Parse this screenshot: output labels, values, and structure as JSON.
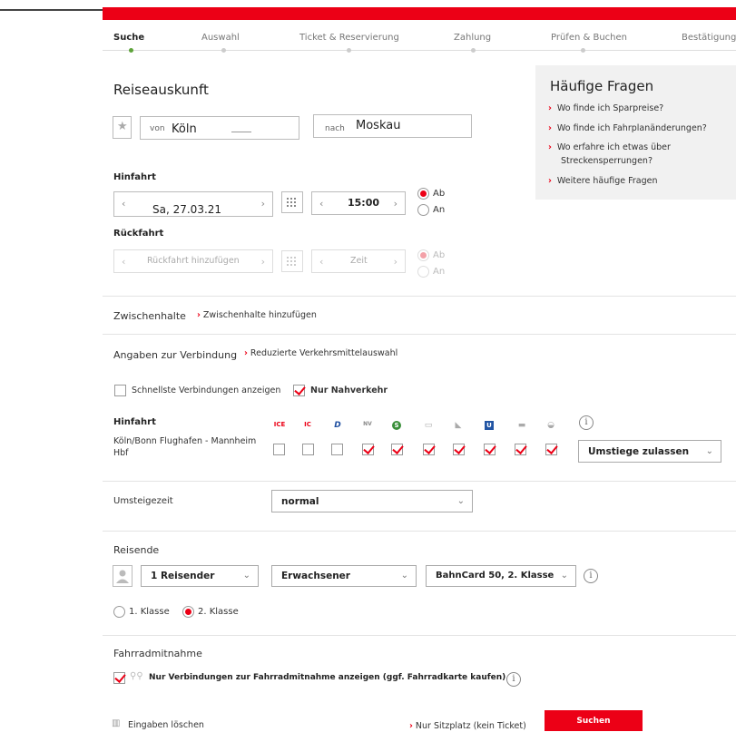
{
  "steps": [
    "Suche",
    "Auswahl",
    "Ticket & Reservierung",
    "Zahlung",
    "Prüfen & Buchen",
    "Bestätigung"
  ],
  "faq": {
    "title": "Häufige Fragen",
    "items": [
      "Wo finde ich Sparpreise?",
      "Wo finde ich Fahrplanänderungen?",
      "Wo erfahre ich etwas über Streckensperrungen?",
      "Weitere häufige Fragen"
    ]
  },
  "search": {
    "title": "Reiseauskunft",
    "from_label": "von",
    "from_value": "Köln",
    "to_label": "nach",
    "to_value": "Moskau"
  },
  "outbound": {
    "title": "Hinfahrt",
    "date": "Sa, 27.03.21",
    "time": "15:00",
    "ab": "Ab",
    "an": "An"
  },
  "return": {
    "title": "Rückfahrt",
    "date_placeholder": "Rückfahrt hinzufügen",
    "time_placeholder": "Zeit",
    "ab": "Ab",
    "an": "An"
  },
  "stops": {
    "label": "Zwischenhalte",
    "link": "Zwischenhalte hinzufügen"
  },
  "connection": {
    "label": "Angaben zur Verbindung",
    "link": "Reduzierte Verkehrsmittelauswahl",
    "fastest": "Schnellste Verbindungen anzeigen",
    "local_only": "Nur Nahverkehr",
    "hin_label": "Hinfahrt",
    "route": "Köln/Bonn Flughafen - Mannheim Hbf",
    "modes": [
      "ICE",
      "IC",
      "D",
      "NV",
      "S",
      "Bus",
      "Schiff",
      "U",
      "Tram",
      "Taxi"
    ],
    "mode_checked": [
      false,
      false,
      false,
      true,
      true,
      true,
      true,
      true,
      true,
      true
    ],
    "transfer_select": "Umstiege zulassen"
  },
  "transfer_time": {
    "label": "Umsteigezeit",
    "value": "normal"
  },
  "travelers": {
    "label": "Reisende",
    "count": "1 Reisender",
    "type": "Erwachsener",
    "bahncard": "BahnCard 50, 2. Klasse",
    "class1": "1. Klasse",
    "class2": "2. Klasse"
  },
  "bike": {
    "label": "Fahrradmitnahme",
    "option": "Nur Verbindungen zur Fahrradmitnahme anzeigen (ggf. Fahrradkarte kaufen)"
  },
  "footer": {
    "clear": "Eingaben löschen",
    "seat_only": "Nur Sitzplatz (kein Ticket)",
    "search_btn": "Suchen"
  },
  "colors": {
    "accent": "#ec0016",
    "progress": "#5da33a"
  }
}
